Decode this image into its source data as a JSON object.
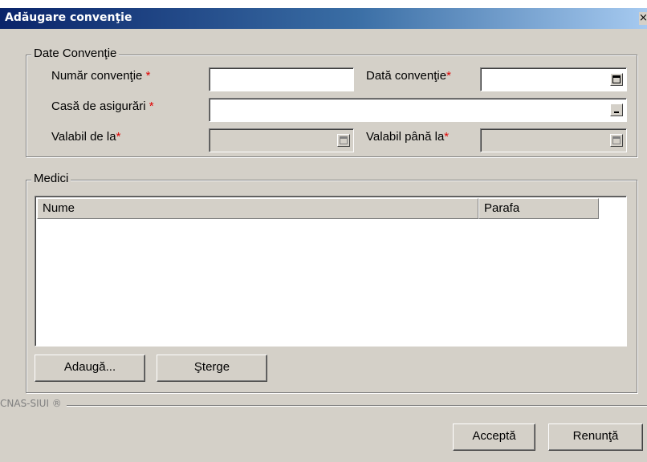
{
  "window": {
    "title": "Adăugare convenţie",
    "close_glyph": "×"
  },
  "conventie_group": {
    "legend": "Date Convenţie",
    "numar_label": "Număr convenţie ",
    "numar_value": "",
    "data_label": "Dată convenţie",
    "data_value": "",
    "casa_label": "Casă de asigurări ",
    "casa_value": "",
    "valabil_de_la_label": "Valabil de la",
    "valabil_de_la_value": "",
    "valabil_pana_la_label": "Valabil până la",
    "valabil_pana_la_value": "",
    "required_mark": "*"
  },
  "medici_group": {
    "legend": "Medici",
    "columns": [
      "Nume",
      "Parafa"
    ],
    "rows": [],
    "add_button": "Adaugă...",
    "delete_button": "Şterge"
  },
  "footer": {
    "brand": "CNAS-SIUI ®",
    "accept_button": "Acceptă",
    "cancel_button": "Renunţă"
  },
  "icons": {
    "close": "close-icon",
    "date_picker": "calendar-icon",
    "dropdown": "dropdown-icon"
  },
  "colors": {
    "titlebar_start": "#0a246a",
    "titlebar_end": "#a6caf0",
    "dialog_bg": "#d4d0c8",
    "required": "#e00000"
  }
}
